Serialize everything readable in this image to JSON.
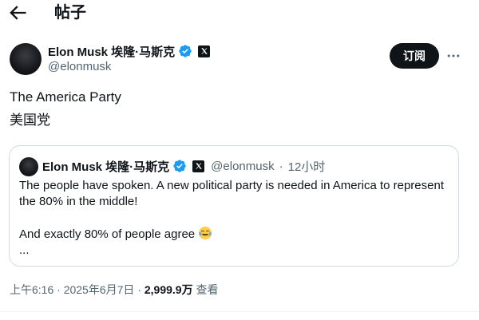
{
  "header": {
    "title": "帖子",
    "back_icon": "arrow-left-icon"
  },
  "post": {
    "author": {
      "name": "Elon Musk 埃隆·马斯克",
      "handle": "@elonmusk",
      "verified_color": "#1d9bf0"
    },
    "subscribe_label": "订阅",
    "more_icon": "more-horizontal-icon",
    "text_lines": [
      "The America Party",
      "美国党"
    ]
  },
  "quote": {
    "author": {
      "name": "Elon Musk 埃隆·马斯克",
      "handle": "@elonmusk",
      "separator": "·",
      "time": "12小时"
    },
    "lines": [
      "The people have spoken. A new political party is needed in America to represent the 80% in the middle!",
      "And exactly 80% of people agree",
      "..."
    ],
    "emoji": "tears-of-joy-emoji"
  },
  "meta": {
    "time": "上午6:16",
    "sep1": "·",
    "date": "2025年6月7日",
    "sep2": "·",
    "views": "2,999.9万",
    "views_label": "查看"
  }
}
